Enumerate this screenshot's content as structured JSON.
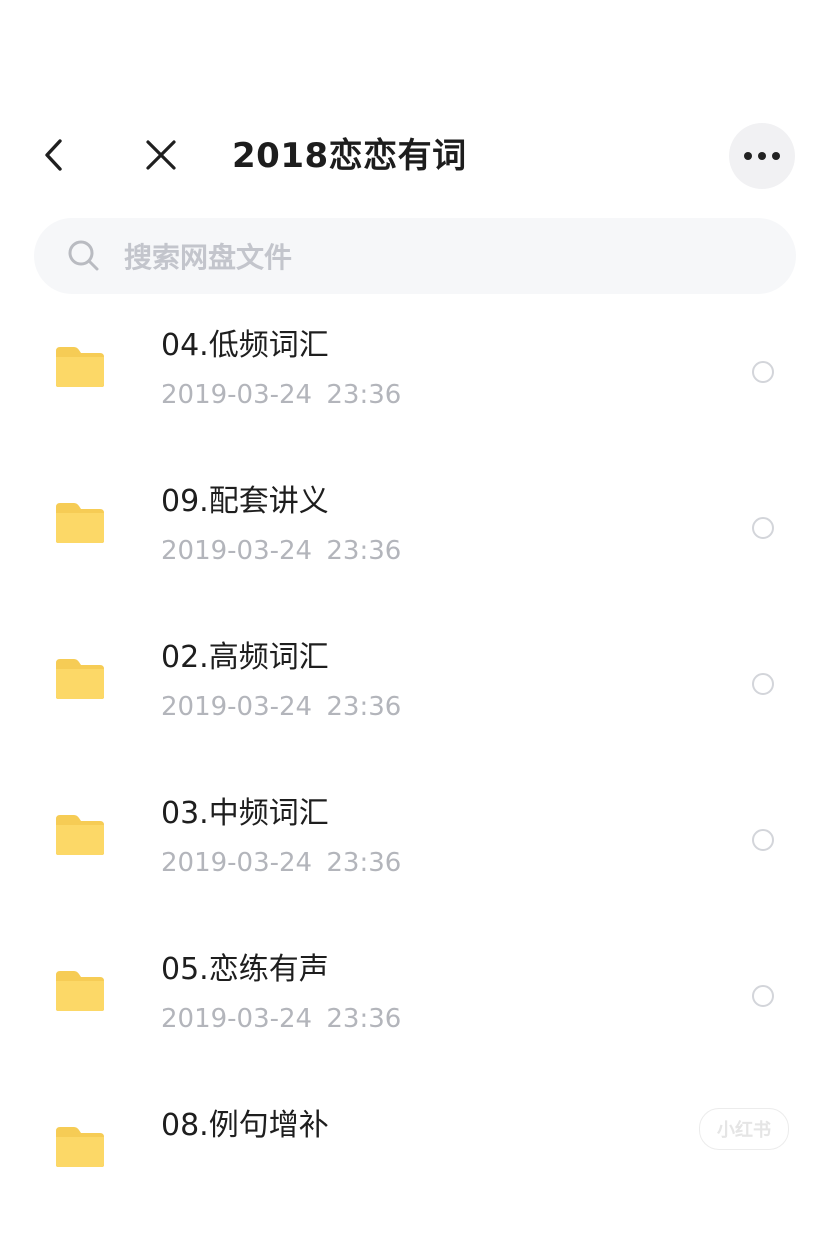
{
  "header": {
    "title": "2018恋恋有词",
    "back_icon": "back-chevron-icon",
    "close_icon": "close-icon",
    "more_icon": "more-dots-icon"
  },
  "search": {
    "placeholder": "搜索网盘文件",
    "icon": "search-icon"
  },
  "files": [
    {
      "name": "04.低频词汇",
      "time": "2019-03-24 23:36",
      "icon": "folder-icon"
    },
    {
      "name": "09.配套讲义",
      "time": "2019-03-24 23:36",
      "icon": "folder-icon"
    },
    {
      "name": "02.高频词汇",
      "time": "2019-03-24 23:36",
      "icon": "folder-icon"
    },
    {
      "name": "03.中频词汇",
      "time": "2019-03-24 23:36",
      "icon": "folder-icon"
    },
    {
      "name": "05.恋练有声",
      "time": "2019-03-24 23:36",
      "icon": "folder-icon"
    },
    {
      "name": "08.例句增补",
      "time": "",
      "icon": "folder-icon"
    }
  ],
  "colors": {
    "folder": "#fcd867",
    "folder_tab": "#f6cc55",
    "secondary_text": "#b3b5bb",
    "search_bg": "#f6f7f9"
  },
  "watermark": {
    "text": "小红书"
  }
}
